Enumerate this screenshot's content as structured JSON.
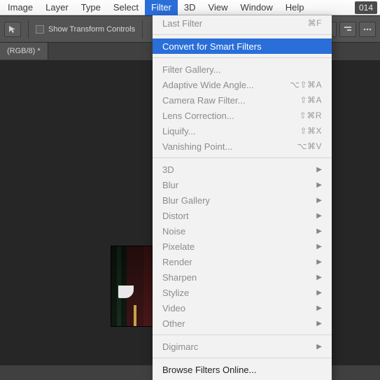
{
  "menubar": {
    "items": [
      {
        "label": "Image"
      },
      {
        "label": "Layer"
      },
      {
        "label": "Type"
      },
      {
        "label": "Select"
      },
      {
        "label": "Filter",
        "active": true
      },
      {
        "label": "3D"
      },
      {
        "label": "View"
      },
      {
        "label": "Window"
      },
      {
        "label": "Help"
      }
    ],
    "version_badge": "014"
  },
  "toolbar": {
    "show_transform_label": "Show Transform Controls"
  },
  "document": {
    "tab_label": "(RGB/8) *"
  },
  "dropdown": {
    "groups": [
      [
        {
          "label": "Last Filter",
          "shortcut": "⌘F",
          "enabled": false
        }
      ],
      [
        {
          "label": "Convert for Smart Filters",
          "enabled": true,
          "selected": true
        }
      ],
      [
        {
          "label": "Filter Gallery...",
          "enabled": false
        },
        {
          "label": "Adaptive Wide Angle...",
          "shortcut": "⌥⇧⌘A",
          "enabled": false
        },
        {
          "label": "Camera Raw Filter...",
          "shortcut": "⇧⌘A",
          "enabled": false
        },
        {
          "label": "Lens Correction...",
          "shortcut": "⇧⌘R",
          "enabled": false
        },
        {
          "label": "Liquify...",
          "shortcut": "⇧⌘X",
          "enabled": false
        },
        {
          "label": "Vanishing Point...",
          "shortcut": "⌥⌘V",
          "enabled": false
        }
      ],
      [
        {
          "label": "3D",
          "submenu": true,
          "enabled": false
        },
        {
          "label": "Blur",
          "submenu": true,
          "enabled": false
        },
        {
          "label": "Blur Gallery",
          "submenu": true,
          "enabled": false
        },
        {
          "label": "Distort",
          "submenu": true,
          "enabled": false
        },
        {
          "label": "Noise",
          "submenu": true,
          "enabled": false
        },
        {
          "label": "Pixelate",
          "submenu": true,
          "enabled": false
        },
        {
          "label": "Render",
          "submenu": true,
          "enabled": false
        },
        {
          "label": "Sharpen",
          "submenu": true,
          "enabled": false
        },
        {
          "label": "Stylize",
          "submenu": true,
          "enabled": false
        },
        {
          "label": "Video",
          "submenu": true,
          "enabled": false
        },
        {
          "label": "Other",
          "submenu": true,
          "enabled": false
        }
      ],
      [
        {
          "label": "Digimarc",
          "submenu": true,
          "enabled": false
        }
      ],
      [
        {
          "label": "Browse Filters Online...",
          "enabled": true
        }
      ]
    ]
  }
}
